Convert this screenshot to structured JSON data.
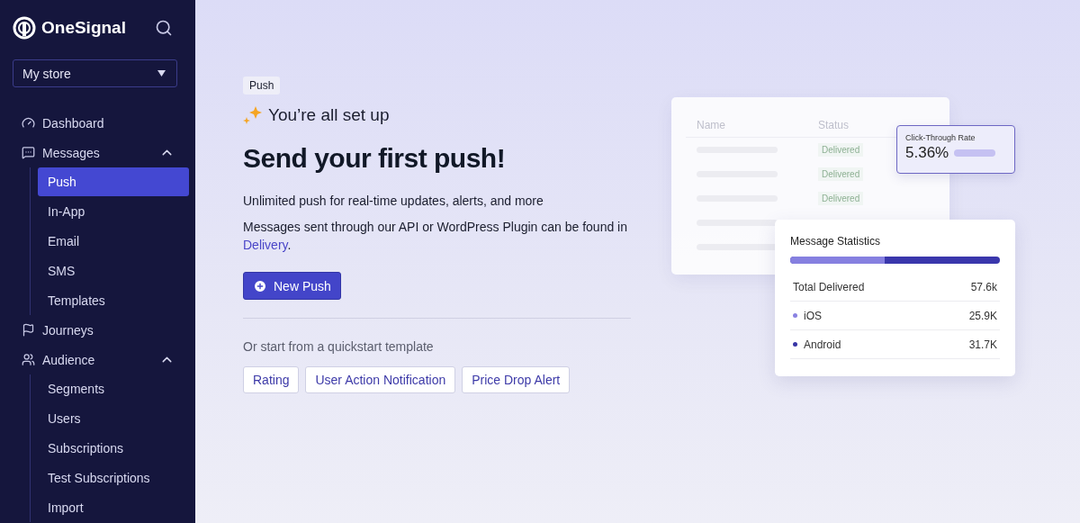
{
  "sidebar": {
    "brand": "OneSignal",
    "app_select": {
      "value": "My store"
    },
    "nav": [
      {
        "label": "Dashboard"
      },
      {
        "label": "Messages",
        "expanded": true,
        "children": [
          {
            "label": "Push",
            "selected": true
          },
          {
            "label": "In-App",
            "selected": false
          },
          {
            "label": "Email",
            "selected": false
          },
          {
            "label": "SMS",
            "selected": false
          },
          {
            "label": "Templates",
            "selected": false
          }
        ]
      },
      {
        "label": "Journeys"
      },
      {
        "label": "Audience",
        "expanded": true,
        "children": [
          {
            "label": "Segments",
            "selected": false
          },
          {
            "label": "Users",
            "selected": false
          },
          {
            "label": "Subscriptions",
            "selected": false
          },
          {
            "label": "Test Subscriptions",
            "selected": false
          },
          {
            "label": "Import",
            "selected": false
          }
        ]
      }
    ]
  },
  "main": {
    "badge": "Push",
    "subtitle": "You’re all set up",
    "title": "Send your first push!",
    "description": "Unlimited push for real-time updates, alerts, and more",
    "note": {
      "text": "Messages sent through our API or WordPress Plugin can be found in",
      "link": "Delivery",
      "tail": "."
    },
    "primary_button": "New Push",
    "quickstart_label": "Or start from a quickstart template",
    "templates": [
      "Rating",
      "User Action Notification",
      "Price Drop Alert"
    ]
  },
  "illustration": {
    "table": {
      "columns": [
        "Name",
        "Status"
      ],
      "rows": [
        {
          "kind": "status",
          "status": "Delivered"
        },
        {
          "kind": "status",
          "status": "Delivered"
        },
        {
          "kind": "status",
          "status": "Delivered"
        },
        {
          "kind": "blank"
        },
        {
          "kind": "blank"
        }
      ]
    },
    "ctr": {
      "label": "Click-Through Rate",
      "value": "5.36%"
    },
    "stats": {
      "title": "Message Statistics",
      "level": 0.45,
      "rows": [
        {
          "kind": "total",
          "label": "Total Delivered",
          "value": "57.6k"
        },
        {
          "kind": "platform",
          "label": "iOS",
          "value": "25.9K",
          "color": "#8a82e2"
        },
        {
          "kind": "platform",
          "label": "Android",
          "value": "31.7K",
          "color": "#3835a6"
        }
      ]
    }
  }
}
